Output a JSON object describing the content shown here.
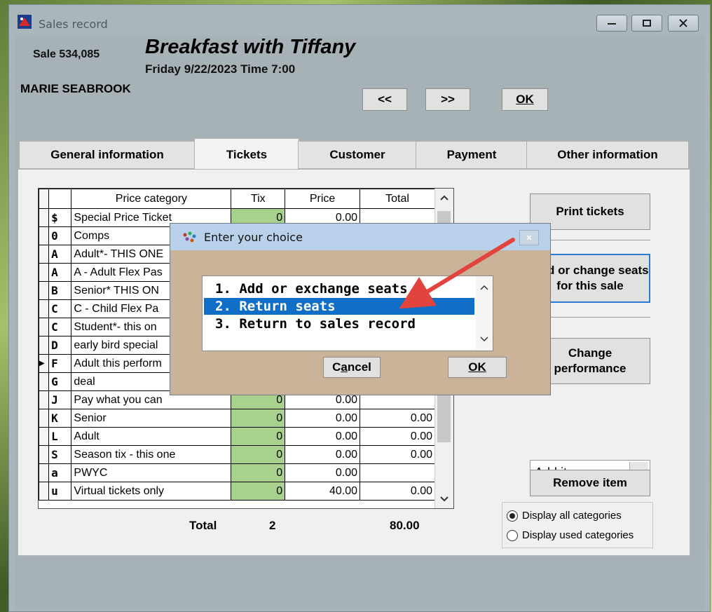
{
  "window": {
    "title": "Sales record",
    "controls": {
      "minimize": "minimize-icon",
      "maximize": "maximize-icon",
      "close": "close-icon"
    }
  },
  "header": {
    "sale_number": "Sale 534,085",
    "show_title": "Breakfast with Tiffany",
    "show_date": "Friday 9/22/2023  Time 7:00",
    "customer_name": "MARIE SEABROOK",
    "prev_label": "<<",
    "next_label": ">>",
    "ok_label": "OK"
  },
  "tabs": [
    {
      "label": "General information",
      "active": false
    },
    {
      "label": "Tickets",
      "active": true
    },
    {
      "label": "Customer",
      "active": false
    },
    {
      "label": "Payment",
      "active": false
    },
    {
      "label": "Other information",
      "active": false
    }
  ],
  "grid": {
    "columns": [
      "",
      "Price category",
      "Tix",
      "Price",
      "Total"
    ],
    "rows": [
      {
        "code": "$",
        "category": "Special Price Ticket",
        "tix": "0",
        "price": "0.00",
        "total": ""
      },
      {
        "code": "0",
        "category": "Comps",
        "tix": "",
        "price": "",
        "total": ""
      },
      {
        "code": "A",
        "category": "Adult*- THIS ONE",
        "tix": "",
        "price": "",
        "total": ""
      },
      {
        "code": "A",
        "category": "A - Adult Flex Pas",
        "tix": "",
        "price": "",
        "total": ""
      },
      {
        "code": "B",
        "category": "Senior* THIS ON",
        "tix": "",
        "price": "",
        "total": ""
      },
      {
        "code": "C",
        "category": "C - Child Flex Pa",
        "tix": "",
        "price": "",
        "total": ""
      },
      {
        "code": "C",
        "category": "Student*- this on",
        "tix": "",
        "price": "",
        "total": ""
      },
      {
        "code": "D",
        "category": "early bird special",
        "tix": "",
        "price": "",
        "total": ""
      },
      {
        "code": "F",
        "category": "Adult this perform",
        "tix": "",
        "price": "",
        "total": "",
        "current": true
      },
      {
        "code": "G",
        "category": "deal",
        "tix": "",
        "price": "",
        "total": ""
      },
      {
        "code": "J",
        "category": "Pay what you can",
        "tix": "0",
        "price": "0.00",
        "total": ""
      },
      {
        "code": "K",
        "category": "Senior",
        "tix": "0",
        "price": "0.00",
        "total": "0.00"
      },
      {
        "code": "L",
        "category": "Adult",
        "tix": "0",
        "price": "0.00",
        "total": "0.00"
      },
      {
        "code": "S",
        "category": "Season tix - this one",
        "tix": "0",
        "price": "0.00",
        "total": "0.00"
      },
      {
        "code": "a",
        "category": "PWYC",
        "tix": "0",
        "price": "0.00",
        "total": ""
      },
      {
        "code": "u",
        "category": "Virtual tickets only",
        "tix": "0",
        "price": "40.00",
        "total": "0.00"
      }
    ]
  },
  "totals": {
    "label": "Total",
    "tix": "2",
    "amount": "80.00"
  },
  "side": {
    "print_tickets": "Print tickets",
    "add_change_seats": "Add or change seats for this sale",
    "change_performance": "Change performance",
    "add_item": "Add item. . .",
    "remove_item": "Remove item",
    "radio_all": "Display all categories",
    "radio_used": "Display used categories"
  },
  "dialog": {
    "title": "Enter your choice",
    "options": [
      "1. Add or exchange seats",
      "2. Return seats",
      "3. Return to sales record"
    ],
    "selected_index": 1,
    "cancel_label": "Cancel",
    "ok_label": "OK"
  },
  "colors": {
    "tix_cell": "#a9d18e",
    "selection": "#0f6fc8",
    "dialog_bg": "#cbb39a",
    "annotation_arrow": "#e0443c"
  }
}
